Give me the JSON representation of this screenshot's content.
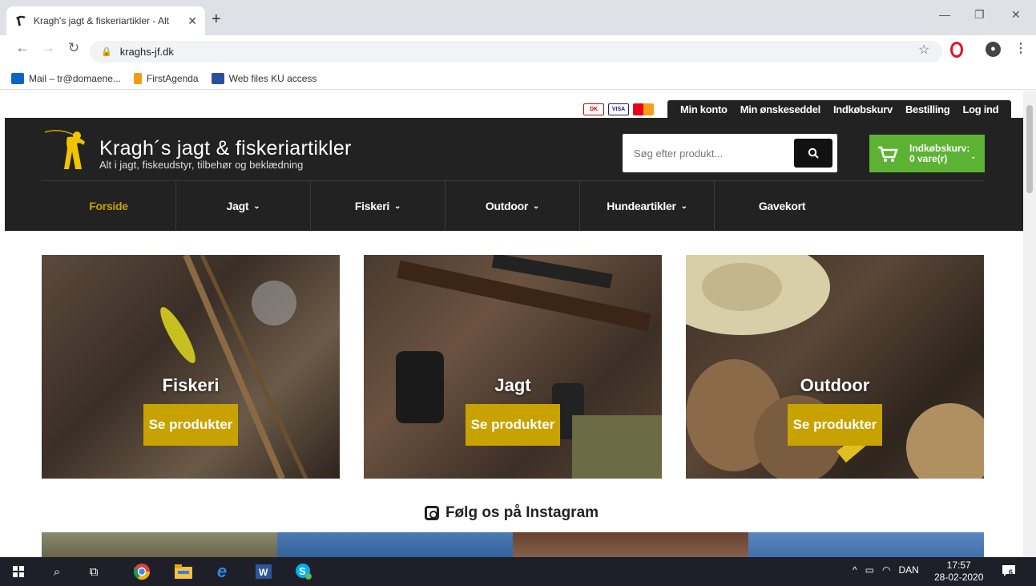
{
  "browser": {
    "tab_title": "Kragh's jagt & fiskeriartikler - Alt",
    "url": "kraghs-jf.dk",
    "bookmarks": [
      {
        "label": "Mail – tr@domaene...",
        "color": "#0a64c8"
      },
      {
        "label": "FirstAgenda",
        "color": "#f39c12"
      },
      {
        "label": "Web files KU access",
        "color": "#2b4f9e"
      }
    ]
  },
  "site": {
    "cards": [
      "DK",
      "VISA",
      "MC"
    ],
    "toplinks": [
      "Min konto",
      "Min ønskeseddel",
      "Indkøbskurv",
      "Bestilling",
      "Log ind"
    ],
    "brand_title": "Kragh´s jagt & fiskeriartikler",
    "brand_subtitle": "Alt i jagt, fiskeudstyr, tilbehør og beklædning",
    "search_placeholder": "Søg efter produkt...",
    "cart_title": "Indkøbskurv:",
    "cart_count": "0 vare(r)",
    "nav": [
      {
        "label": "Forside",
        "chevron": false
      },
      {
        "label": "Jagt",
        "chevron": true
      },
      {
        "label": "Fiskeri",
        "chevron": true
      },
      {
        "label": "Outdoor",
        "chevron": true
      },
      {
        "label": "Hundeartikler",
        "chevron": true
      },
      {
        "label": "Gavekort",
        "chevron": false
      }
    ],
    "tiles": [
      {
        "label": "Fiskeri",
        "button": "Se produkter"
      },
      {
        "label": "Jagt",
        "button": "Se produkter"
      },
      {
        "label": "Outdoor",
        "button": "Se produkter"
      }
    ],
    "instagram_heading": "Følg os på Instagram"
  },
  "taskbar": {
    "language": "DAN",
    "time": "17:57",
    "date": "28-02-2020",
    "notification_count": "6"
  },
  "colors": {
    "accent_gold": "#c8a200",
    "cart_green": "#5cb333",
    "header_dark": "#222222"
  }
}
